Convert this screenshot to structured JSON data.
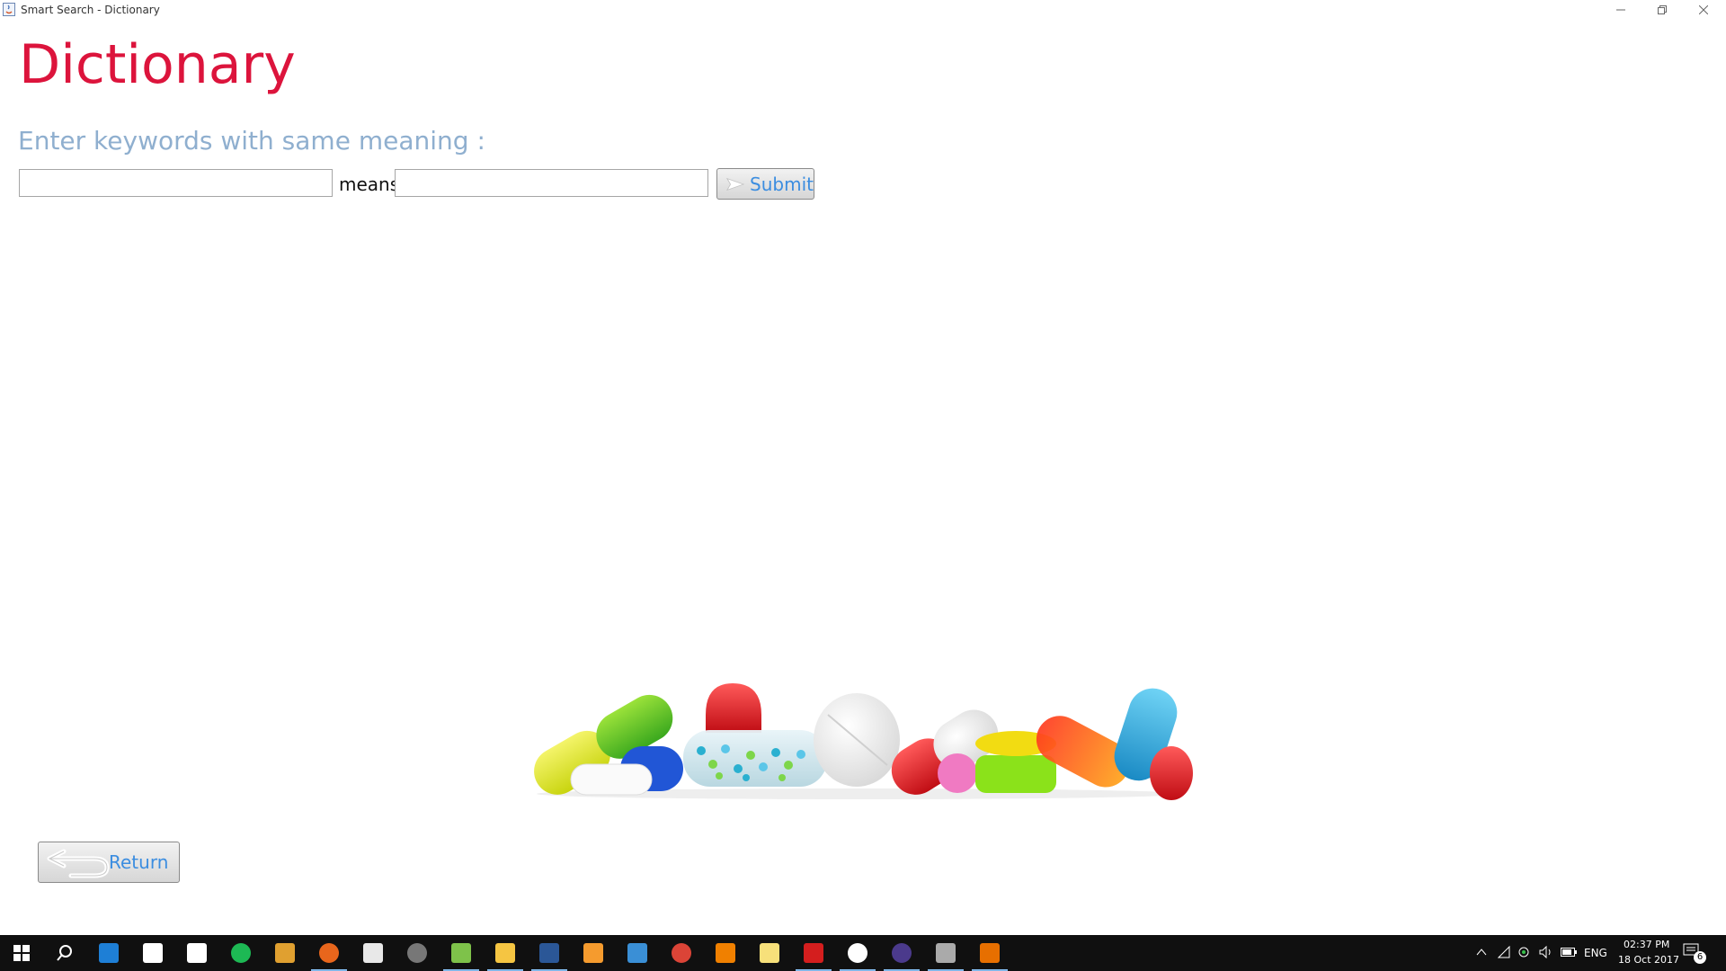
{
  "window": {
    "title": "Smart Search - Dictionary"
  },
  "page": {
    "heading": "Dictionary",
    "prompt": "Enter keywords with same meaning :",
    "means_label": "means",
    "keyword_value": "",
    "meaning_value": "",
    "submit_label": "Submit",
    "return_label": "Return"
  },
  "taskbar": {
    "apps": [
      {
        "icon": "search-icon",
        "color": "#ffffff"
      },
      {
        "icon": "edge-icon",
        "color": "#1e7fd6"
      },
      {
        "icon": "store-icon",
        "color": "#ffffff"
      },
      {
        "icon": "home-icon",
        "color": "#ffffff"
      },
      {
        "icon": "spotify-icon",
        "color": "#1db954"
      },
      {
        "icon": "app-yellow-icon",
        "color": "#e0a030"
      },
      {
        "icon": "firefox-icon",
        "color": "#e8661c"
      },
      {
        "icon": "notepad-icon",
        "color": "#e8e8e8"
      },
      {
        "icon": "app-circle-icon",
        "color": "#777777"
      },
      {
        "icon": "excel-icon",
        "color": "#7ec24a"
      },
      {
        "icon": "file-explorer-icon",
        "color": "#f5c542"
      },
      {
        "icon": "word-icon",
        "color": "#2b5797"
      },
      {
        "icon": "media-player-icon",
        "color": "#f59b2e"
      },
      {
        "icon": "app-blue-icon",
        "color": "#3a8fd6"
      },
      {
        "icon": "chrome-icon",
        "color": "#db4437"
      },
      {
        "icon": "vlc-icon",
        "color": "#f08000"
      },
      {
        "icon": "sticky-notes-icon",
        "color": "#f7e07a"
      },
      {
        "icon": "acrobat-icon",
        "color": "#d41e1e"
      },
      {
        "icon": "slack-icon",
        "color": "#ffffff"
      },
      {
        "icon": "eclipse-icon",
        "color": "#4b3a8c"
      },
      {
        "icon": "app-cat-icon",
        "color": "#aaaaaa"
      },
      {
        "icon": "java-icon",
        "color": "#e76f00"
      }
    ],
    "tray": {
      "language": "ENG",
      "time": "02:37 PM",
      "date": "18 Oct 2017",
      "notifications": "6"
    }
  }
}
